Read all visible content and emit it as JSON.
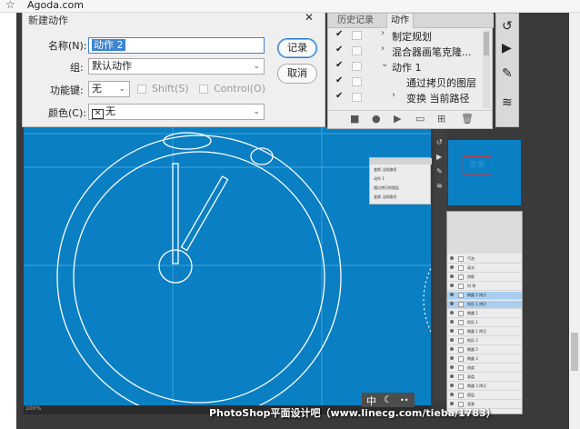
{
  "browser": {
    "bookmark": "Agoda.com"
  },
  "dialog": {
    "title": "新建动作",
    "name_label": "名称(N):",
    "name_value": "动作 2",
    "group_label": "组:",
    "group_value": "默认动作",
    "function_key_label": "功能键:",
    "function_key_value": "无",
    "shift_label": "Shift(S)",
    "control_label": "Control(O)",
    "color_label": "颜色(C):",
    "color_value": "无",
    "record_button": "记录",
    "cancel_button": "取消"
  },
  "history_panel": {
    "tabs": [
      "历史记录",
      "动作"
    ],
    "rows": [
      {
        "text": "制定规划",
        "arrow": true,
        "checked": true
      },
      {
        "text": "混合器画笔克隆...",
        "arrow": true,
        "checked": true
      },
      {
        "text": "动作 1",
        "arrow": false,
        "checked": true
      },
      {
        "text": "通过拷贝的图层",
        "arrow": false,
        "checked": true
      },
      {
        "text": "变换 当前路径",
        "arrow": true,
        "checked": true
      }
    ]
  },
  "float_history": {
    "rows": [
      "变换 当前路径",
      "动作 1",
      "通过拷贝的图层",
      "变换 当前路径"
    ]
  },
  "preview": {
    "text": "像素"
  },
  "layers": {
    "rows": [
      {
        "name": "气泡",
        "selected": false
      },
      {
        "name": "高光",
        "selected": false
      },
      {
        "name": "阴影",
        "selected": false
      },
      {
        "name": "时 钟",
        "selected": false
      },
      {
        "name": "椭圆 2 拷贝",
        "selected": true
      },
      {
        "name": "矩形 1 拷贝",
        "selected": true
      },
      {
        "name": "椭圆 1",
        "selected": false
      },
      {
        "name": "矩形 1",
        "selected": false
      },
      {
        "name": "椭圆 1 拷贝",
        "selected": false
      },
      {
        "name": "矩形 2",
        "selected": false
      },
      {
        "name": "椭圆 2",
        "selected": false
      },
      {
        "name": "椭圆 3",
        "selected": false
      },
      {
        "name": "刻度",
        "selected": false
      },
      {
        "name": "表盘",
        "selected": false
      },
      {
        "name": "椭圆 3 拷贝",
        "selected": false
      },
      {
        "name": "图层",
        "selected": false
      },
      {
        "name": "背景",
        "selected": false
      }
    ]
  },
  "status": {
    "zoom": "100%"
  },
  "ime": {
    "mode": "中",
    "moon": "☾",
    "dots": "••"
  },
  "watermark": "PhotoShop平面设计吧（www.linecg.com/tieba/1783）",
  "colors": {
    "canvas_blue": "#0a7fc3",
    "selection_blue": "#3c84d0",
    "layer_selected": "#a8cff1"
  }
}
